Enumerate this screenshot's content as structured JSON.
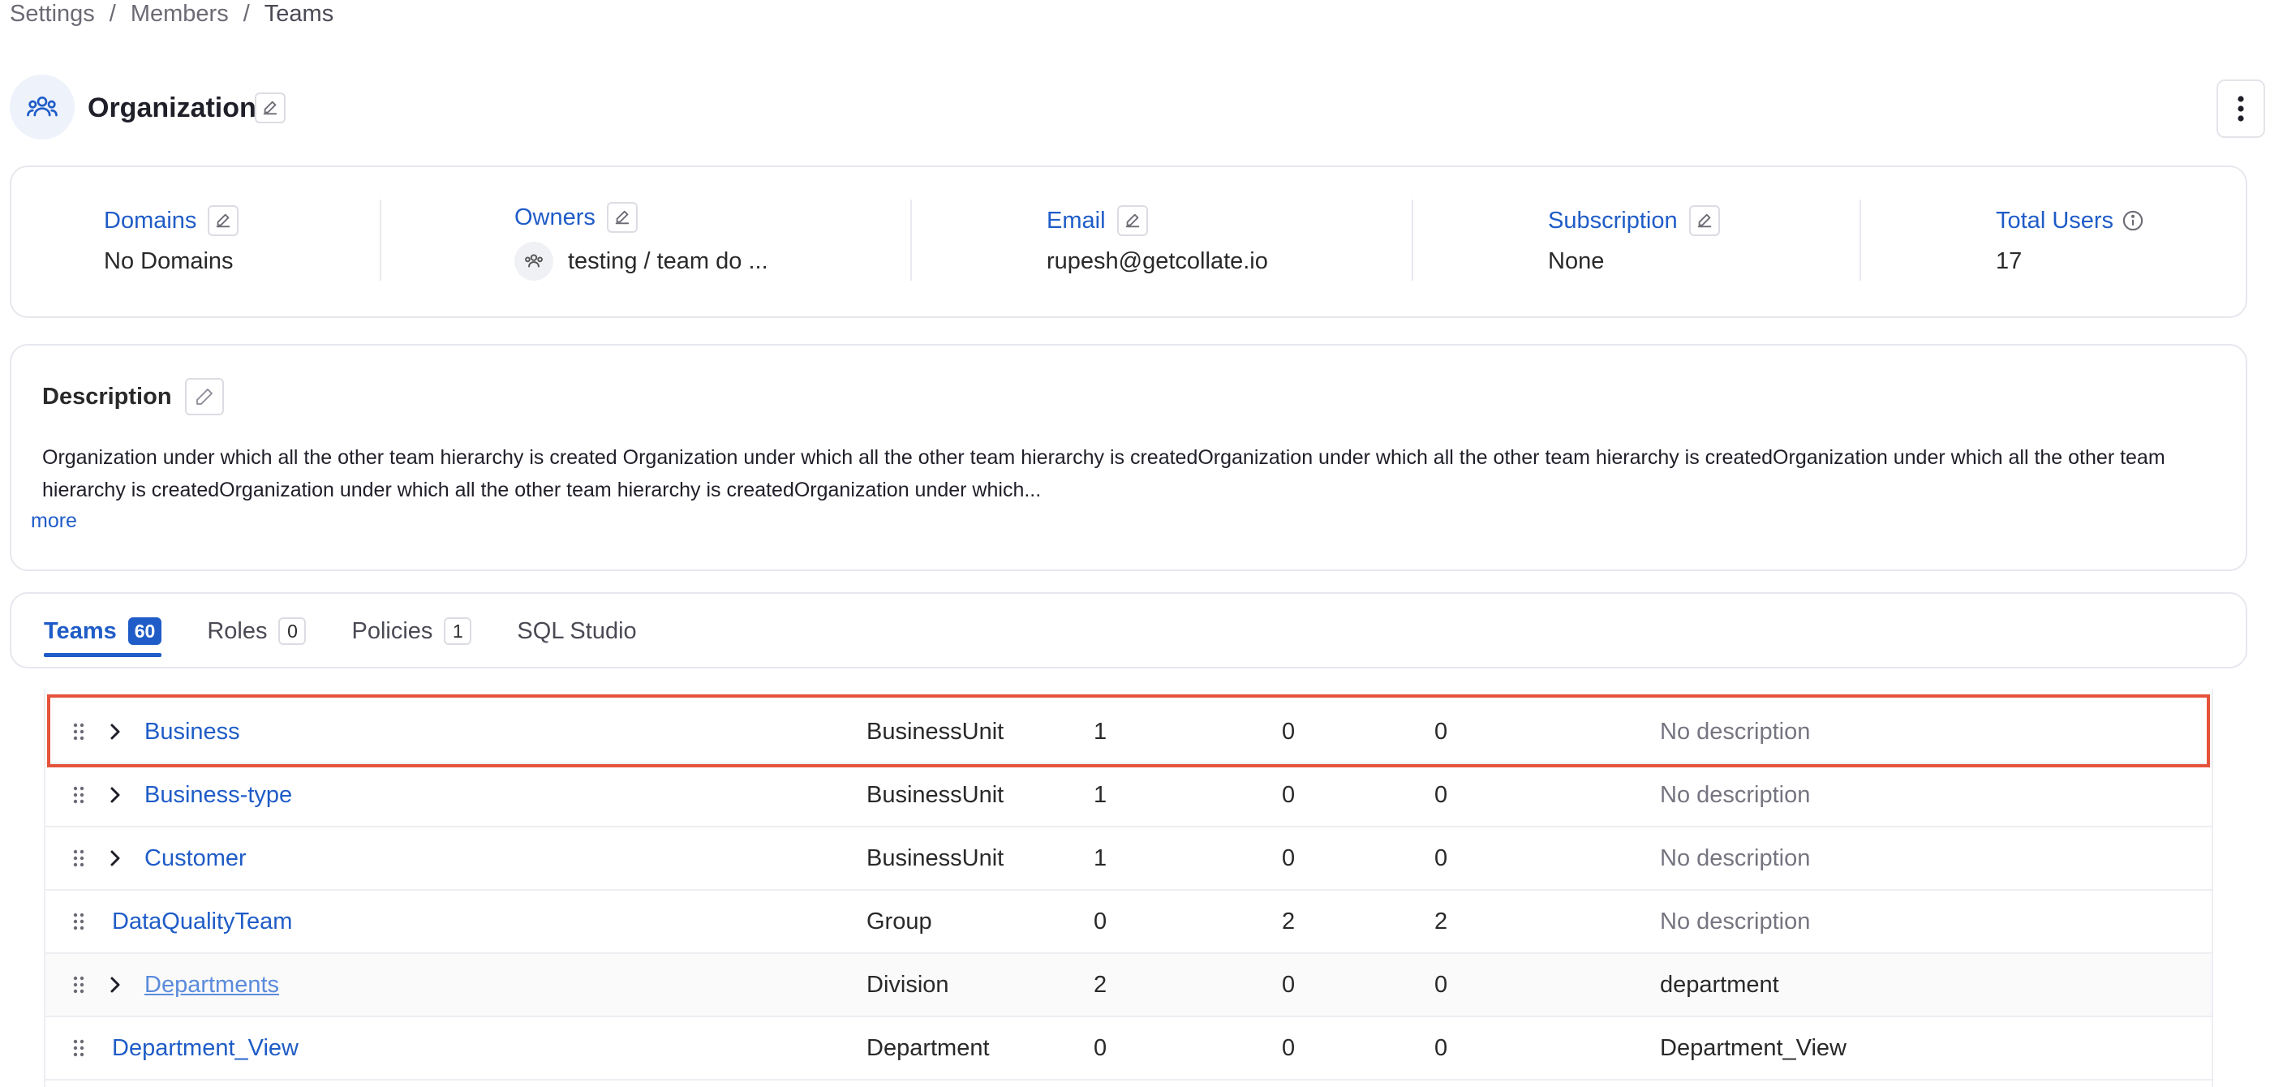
{
  "breadcrumb": {
    "items": [
      "Settings",
      "Members",
      "Teams"
    ],
    "separator": "/"
  },
  "header": {
    "title": "Organization"
  },
  "info": {
    "domains": {
      "label": "Domains",
      "value": "No Domains"
    },
    "owners": {
      "label": "Owners",
      "value": "testing / team do ..."
    },
    "email": {
      "label": "Email",
      "value": "rupesh@getcollate.io"
    },
    "subscription": {
      "label": "Subscription",
      "value": "None"
    },
    "total_users": {
      "label": "Total Users",
      "value": "17"
    }
  },
  "description": {
    "title": "Description",
    "text": "Organization under which all the other team hierarchy is created Organization under which all the other team hierarchy is createdOrganization under which all the other team hierarchy is createdOrganization under which all the other team hierarchy is createdOrganization under which all the other team hierarchy is createdOrganization under which...",
    "more_label": "more"
  },
  "tabs": [
    {
      "label": "Teams",
      "count": "60",
      "active": true
    },
    {
      "label": "Roles",
      "count": "0",
      "active": false
    },
    {
      "label": "Policies",
      "count": "1",
      "active": false
    },
    {
      "label": "SQL Studio",
      "count": "",
      "active": false
    }
  ],
  "table": {
    "rows": [
      {
        "name": "Business",
        "type": "BusinessUnit",
        "c1": "1",
        "c2": "0",
        "c3": "0",
        "description": "No description",
        "expandable": true
      },
      {
        "name": "Business-type",
        "type": "BusinessUnit",
        "c1": "1",
        "c2": "0",
        "c3": "0",
        "description": "No description",
        "expandable": true
      },
      {
        "name": "Customer",
        "type": "BusinessUnit",
        "c1": "1",
        "c2": "0",
        "c3": "0",
        "description": "No description",
        "expandable": true
      },
      {
        "name": "DataQualityTeam",
        "type": "Group",
        "c1": "0",
        "c2": "2",
        "c3": "2",
        "description": "No description",
        "expandable": false
      },
      {
        "name": "Departments",
        "type": "Division",
        "c1": "2",
        "c2": "0",
        "c3": "0",
        "description": "department",
        "expandable": true
      },
      {
        "name": "Department_View",
        "type": "Department",
        "c1": "0",
        "c2": "0",
        "c3": "0",
        "description": "Department_View",
        "expandable": false
      }
    ]
  },
  "colors": {
    "accent": "#1f5cc7",
    "highlight": "#e5533a"
  }
}
